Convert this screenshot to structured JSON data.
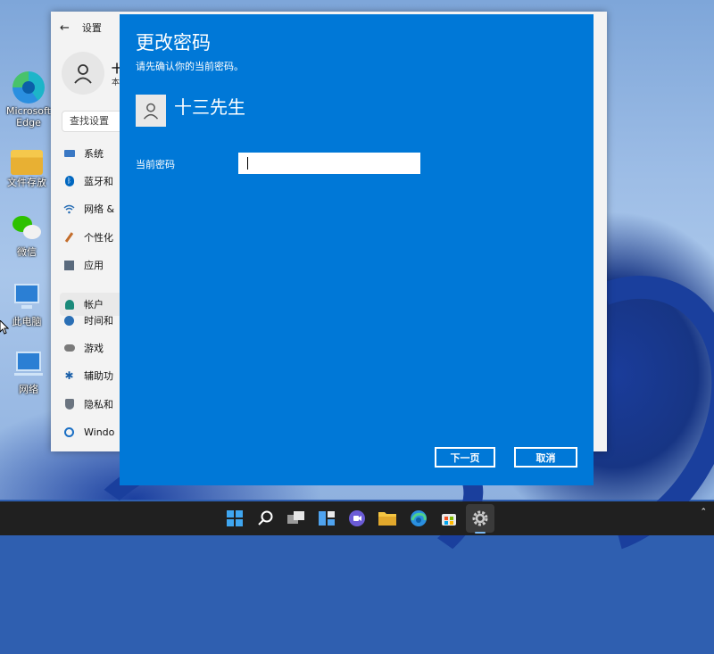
{
  "desktop": {
    "icons": [
      {
        "label": "Microsoft Edge",
        "icon": "edge-icon"
      },
      {
        "label": "文件存放",
        "icon": "folder-icon"
      },
      {
        "label": "微信",
        "icon": "wechat-icon"
      },
      {
        "label": "此电脑",
        "icon": "computer-icon"
      },
      {
        "label": "网络",
        "icon": "network-icon"
      }
    ]
  },
  "settings": {
    "title": "设置",
    "user_name": "十",
    "user_sub": "本",
    "search_placeholder": "查找设置",
    "nav": [
      {
        "label": "系统",
        "icon": "display-icon"
      },
      {
        "label": "蓝牙和",
        "icon": "bluetooth-icon"
      },
      {
        "label": "网络 &",
        "icon": "wifi-icon"
      },
      {
        "label": "个性化",
        "icon": "brush-icon"
      },
      {
        "label": "应用",
        "icon": "apps-icon"
      },
      {
        "label": "帐户",
        "icon": "person-icon"
      },
      {
        "label": "时间和",
        "icon": "clock-icon"
      },
      {
        "label": "游戏",
        "icon": "gamepad-icon"
      },
      {
        "label": "辅助功",
        "icon": "accessibility-icon"
      },
      {
        "label": "隐私和",
        "icon": "shield-icon"
      },
      {
        "label": "Windo",
        "icon": "update-icon"
      }
    ],
    "active_index": 5
  },
  "dialog": {
    "title": "更改密码",
    "subtitle": "请先确认你的当前密码。",
    "user_name": "十三先生",
    "password_label": "当前密码",
    "password_value": "",
    "next_label": "下一页",
    "cancel_label": "取消"
  },
  "taskbar": {
    "apps": [
      "windows-start-icon",
      "search-icon",
      "task-view-icon",
      "widgets-icon",
      "teams-chat-icon",
      "file-explorer-icon",
      "edge-icon",
      "store-icon",
      "settings-icon"
    ],
    "active_app": "settings-icon"
  },
  "colors": {
    "dialog_bg": "#0078d7",
    "taskbar_bg": "#202020",
    "accent": "#0067c0"
  }
}
